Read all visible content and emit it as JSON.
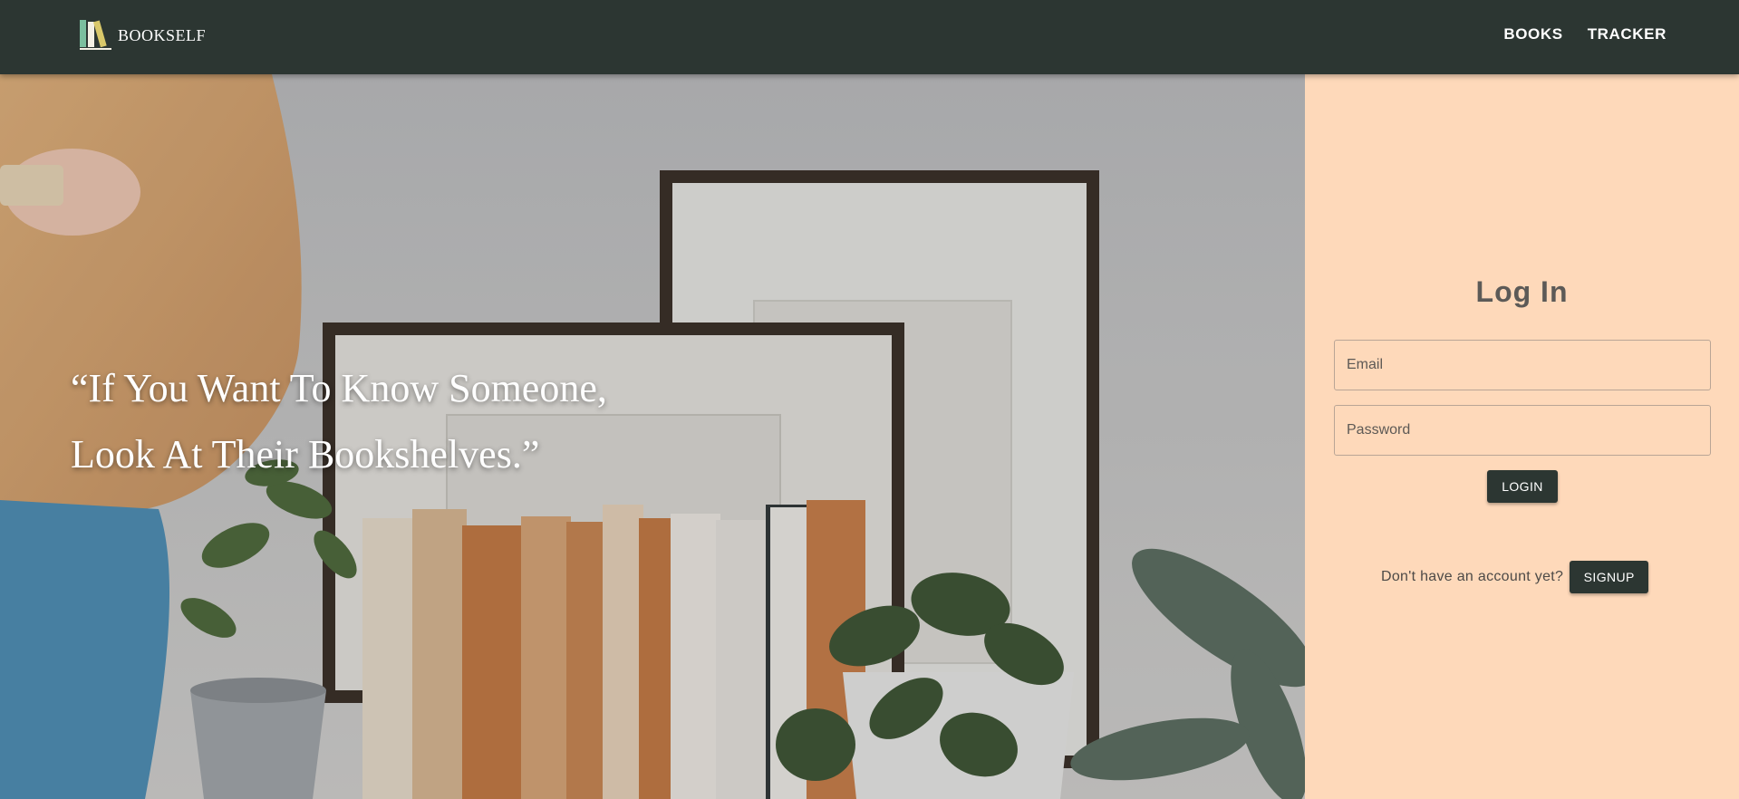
{
  "navbar": {
    "brand": "BOOKSELF",
    "logo_icon": "bookshelf-logo-icon",
    "links": [
      "BOOKS",
      "TRACKER"
    ]
  },
  "hero": {
    "quote_line1": "“If You Want To Know Someone,",
    "quote_line2": "Look At Their Bookshelves.”"
  },
  "login": {
    "title": "Log In",
    "email_placeholder": "Email",
    "password_placeholder": "Password",
    "login_label": "LOGIN",
    "signup_prompt": "Don't have an account yet?",
    "signup_label": "SIGNUP"
  },
  "colors": {
    "navbar": "#2c3632",
    "panel": "#fed9ba",
    "button": "#2c3632",
    "logo_green": "#7bbf9e",
    "logo_cream": "#f4f0e4",
    "logo_yellow": "#d9c86a"
  }
}
